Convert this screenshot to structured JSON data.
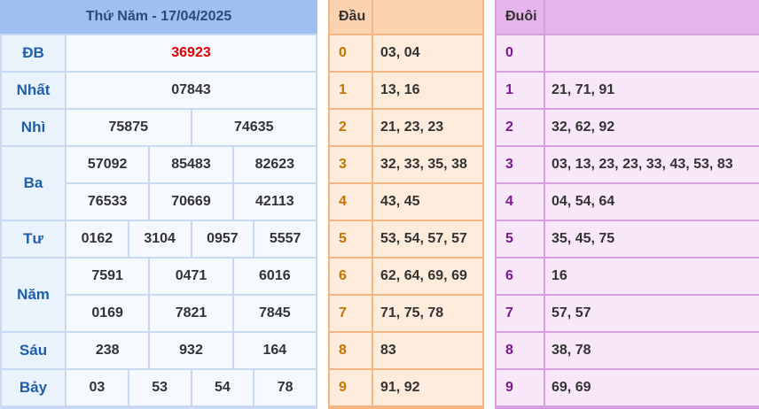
{
  "results": {
    "title": "Thứ Năm - 17/04/2025",
    "prizes": [
      {
        "label": "ĐB",
        "rows": [
          [
            "36923"
          ]
        ]
      },
      {
        "label": "Nhất",
        "rows": [
          [
            "07843"
          ]
        ]
      },
      {
        "label": "Nhì",
        "rows": [
          [
            "75875",
            "74635"
          ]
        ]
      },
      {
        "label": "Ba",
        "rows": [
          [
            "57092",
            "85483",
            "82623"
          ],
          [
            "76533",
            "70669",
            "42113"
          ]
        ]
      },
      {
        "label": "Tư",
        "rows": [
          [
            "0162",
            "3104",
            "0957",
            "5557"
          ]
        ]
      },
      {
        "label": "Năm",
        "rows": [
          [
            "7591",
            "0471",
            "6016"
          ],
          [
            "0169",
            "7821",
            "7845"
          ]
        ]
      },
      {
        "label": "Sáu",
        "rows": [
          [
            "238",
            "932",
            "164"
          ]
        ]
      },
      {
        "label": "Bảy",
        "rows": [
          [
            "03",
            "53",
            "54",
            "78"
          ]
        ]
      }
    ]
  },
  "dau": {
    "header": "Đầu",
    "rows": [
      {
        "key": "0",
        "values": "03, 04"
      },
      {
        "key": "1",
        "values": "13, 16"
      },
      {
        "key": "2",
        "values": "21, 23, 23"
      },
      {
        "key": "3",
        "values": "32, 33, 35, 38"
      },
      {
        "key": "4",
        "values": "43, 45"
      },
      {
        "key": "5",
        "values": "53, 54, 57, 57"
      },
      {
        "key": "6",
        "values": "62, 64, 69, 69"
      },
      {
        "key": "7",
        "values": "71, 75, 78"
      },
      {
        "key": "8",
        "values": "83"
      },
      {
        "key": "9",
        "values": "91, 92"
      }
    ]
  },
  "duoi": {
    "header": "Đuôi",
    "rows": [
      {
        "key": "0",
        "values": ""
      },
      {
        "key": "1",
        "values": "21, 71, 91"
      },
      {
        "key": "2",
        "values": "32, 62, 92"
      },
      {
        "key": "3",
        "values": "03, 13, 23, 23, 33, 43, 53, 83"
      },
      {
        "key": "4",
        "values": "04, 54, 64"
      },
      {
        "key": "5",
        "values": "35, 45, 75"
      },
      {
        "key": "6",
        "values": "16"
      },
      {
        "key": "7",
        "values": "57, 57"
      },
      {
        "key": "8",
        "values": "38, 78"
      },
      {
        "key": "9",
        "values": "69, 69"
      }
    ]
  },
  "colors": {
    "special_prize": "#e00000",
    "results_header": "#9dc0f0",
    "dau_header": "#fbd3b0",
    "duoi_header": "#e6b4ec"
  }
}
